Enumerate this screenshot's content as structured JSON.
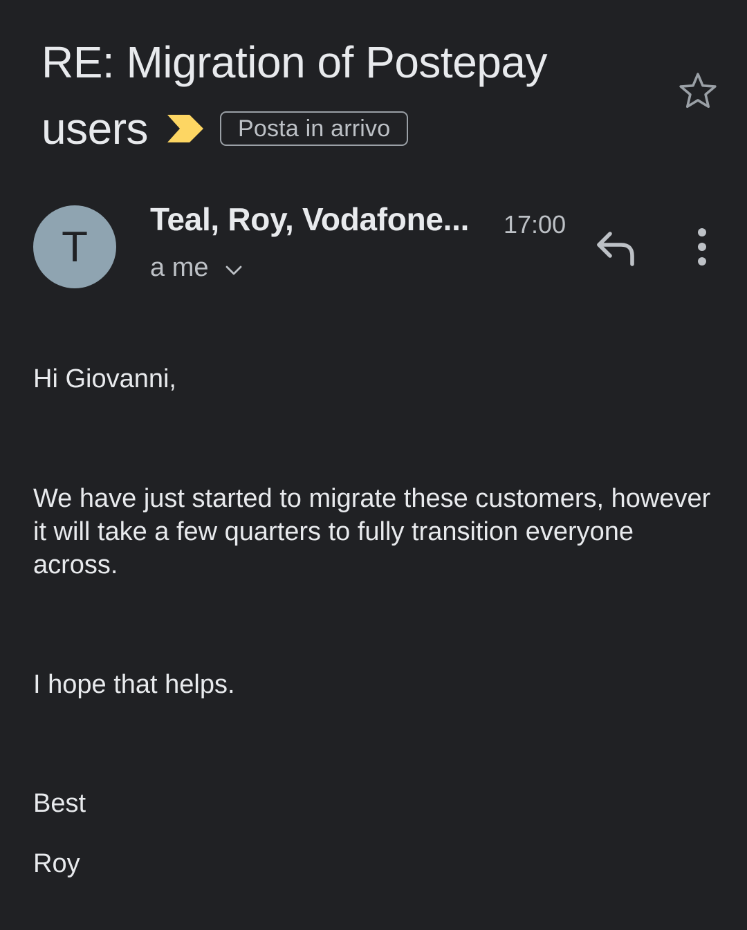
{
  "subject": {
    "line1": "RE: Migration of Postepay",
    "line2": "users",
    "label": "Posta in arrivo"
  },
  "message": {
    "avatar_letter": "T",
    "sender": "Teal, Roy, Vodafone...",
    "time": "17:00",
    "recipients": "a me"
  },
  "body": {
    "greeting": "Hi Giovanni,",
    "paragraph": "We have just started to migrate these customers, however it will take a few quarters to fully transition everyone across.",
    "closing_line": "I hope that helps.",
    "signoff": "Best",
    "signature": "Roy"
  },
  "icons": {
    "importance": "importance-marker-icon",
    "star": "star-outline-icon",
    "reply": "reply-icon",
    "more": "more-vert-icon",
    "expand": "chevron-down-icon"
  },
  "colors": {
    "background": "#202124",
    "importance": "#fdd663",
    "avatar": "#8fa4b1"
  }
}
